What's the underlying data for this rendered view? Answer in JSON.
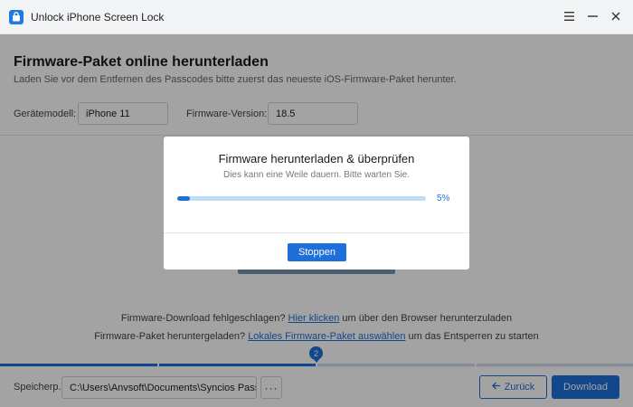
{
  "app": {
    "title": "Unlock iPhone Screen Lock",
    "window_controls": {
      "menu_icon": "menu-icon",
      "minimize_icon": "minimize-icon",
      "close_icon": "close-icon"
    }
  },
  "page": {
    "title": "Firmware-Paket online herunterladen",
    "subtitle": "Laden Sie vor dem Entfernen des Passcodes bitte zuerst das neueste iOS-Firmware-Paket herunter."
  },
  "fields": {
    "device_model_label": "Gerätemodell:",
    "device_model_value": "iPhone 11",
    "firmware_version_label": "Firmware-Version:",
    "firmware_version_value": "18.5"
  },
  "help": {
    "line1_prefix": "Firmware-Download fehlgeschlagen?",
    "line1_link": "Hier klicken",
    "line1_suffix": "um über den Browser herunterzuladen",
    "line2_prefix": "Firmware-Paket heruntergeladen?",
    "line2_link": "Lokales Firmware-Paket auswählen",
    "line2_suffix": "um das Entsperren zu starten"
  },
  "steps": {
    "current_step": "2",
    "total_segments": 4,
    "completed_segments": 2
  },
  "bottom": {
    "path_label": "Speicherp...",
    "path_value": "C:\\Users\\Anvsoft\\Documents\\Syncios Passco",
    "more_label": "···",
    "back_label": "Zurück",
    "download_label": "Download"
  },
  "modal": {
    "title": "Firmware herunterladen & überprüfen",
    "subtitle": "Dies kann eine Weile dauern. Bitte warten Sie.",
    "progress_percent": 5,
    "progress_label": "5%",
    "stop_label": "Stoppen"
  },
  "colors": {
    "accent": "#1e6fd9",
    "track": "#bfdcf7",
    "step_inactive": "#cfdcec",
    "step_active": "#1e6fd9"
  }
}
